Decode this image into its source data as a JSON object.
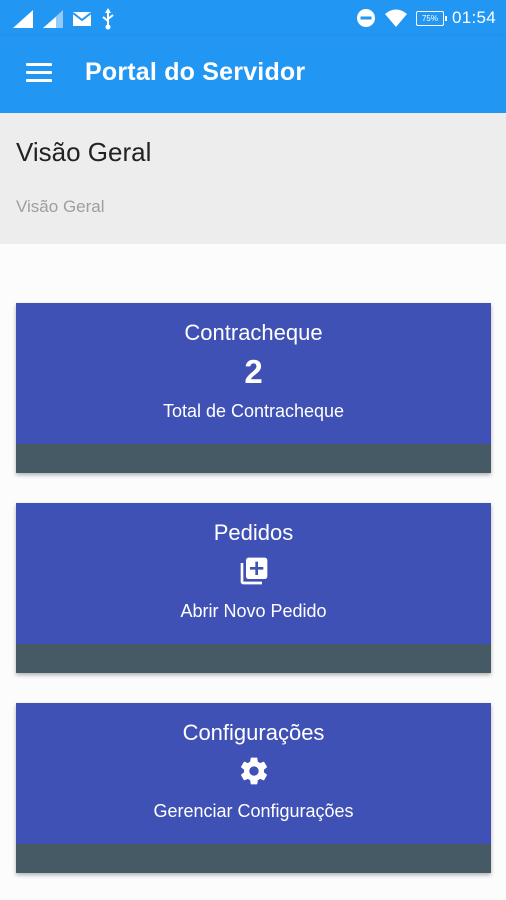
{
  "status_bar": {
    "time": "01:54",
    "battery": "75%",
    "icons": [
      "signal-icon",
      "signal-icon-2",
      "mail-icon",
      "usb-icon",
      "do-not-disturb-icon",
      "wifi-icon",
      "battery-icon"
    ]
  },
  "app_bar": {
    "title": "Portal do Servidor",
    "menu_icon": "menu-icon"
  },
  "header": {
    "title": "Visão Geral",
    "breadcrumb": "Visão Geral"
  },
  "cards": [
    {
      "title": "Contracheque",
      "value": "2",
      "subtitle": "Total de Contracheque"
    },
    {
      "title": "Pedidos",
      "icon": "add-to-library-icon",
      "subtitle": "Abrir Novo Pedido"
    },
    {
      "title": "Configurações",
      "icon": "gear-icon",
      "subtitle": "Gerenciar Configurações"
    }
  ],
  "colors": {
    "primary": "#2196f3",
    "card": "#3f51b5",
    "card_footer": "#455a64",
    "header_bg": "#ededed"
  }
}
